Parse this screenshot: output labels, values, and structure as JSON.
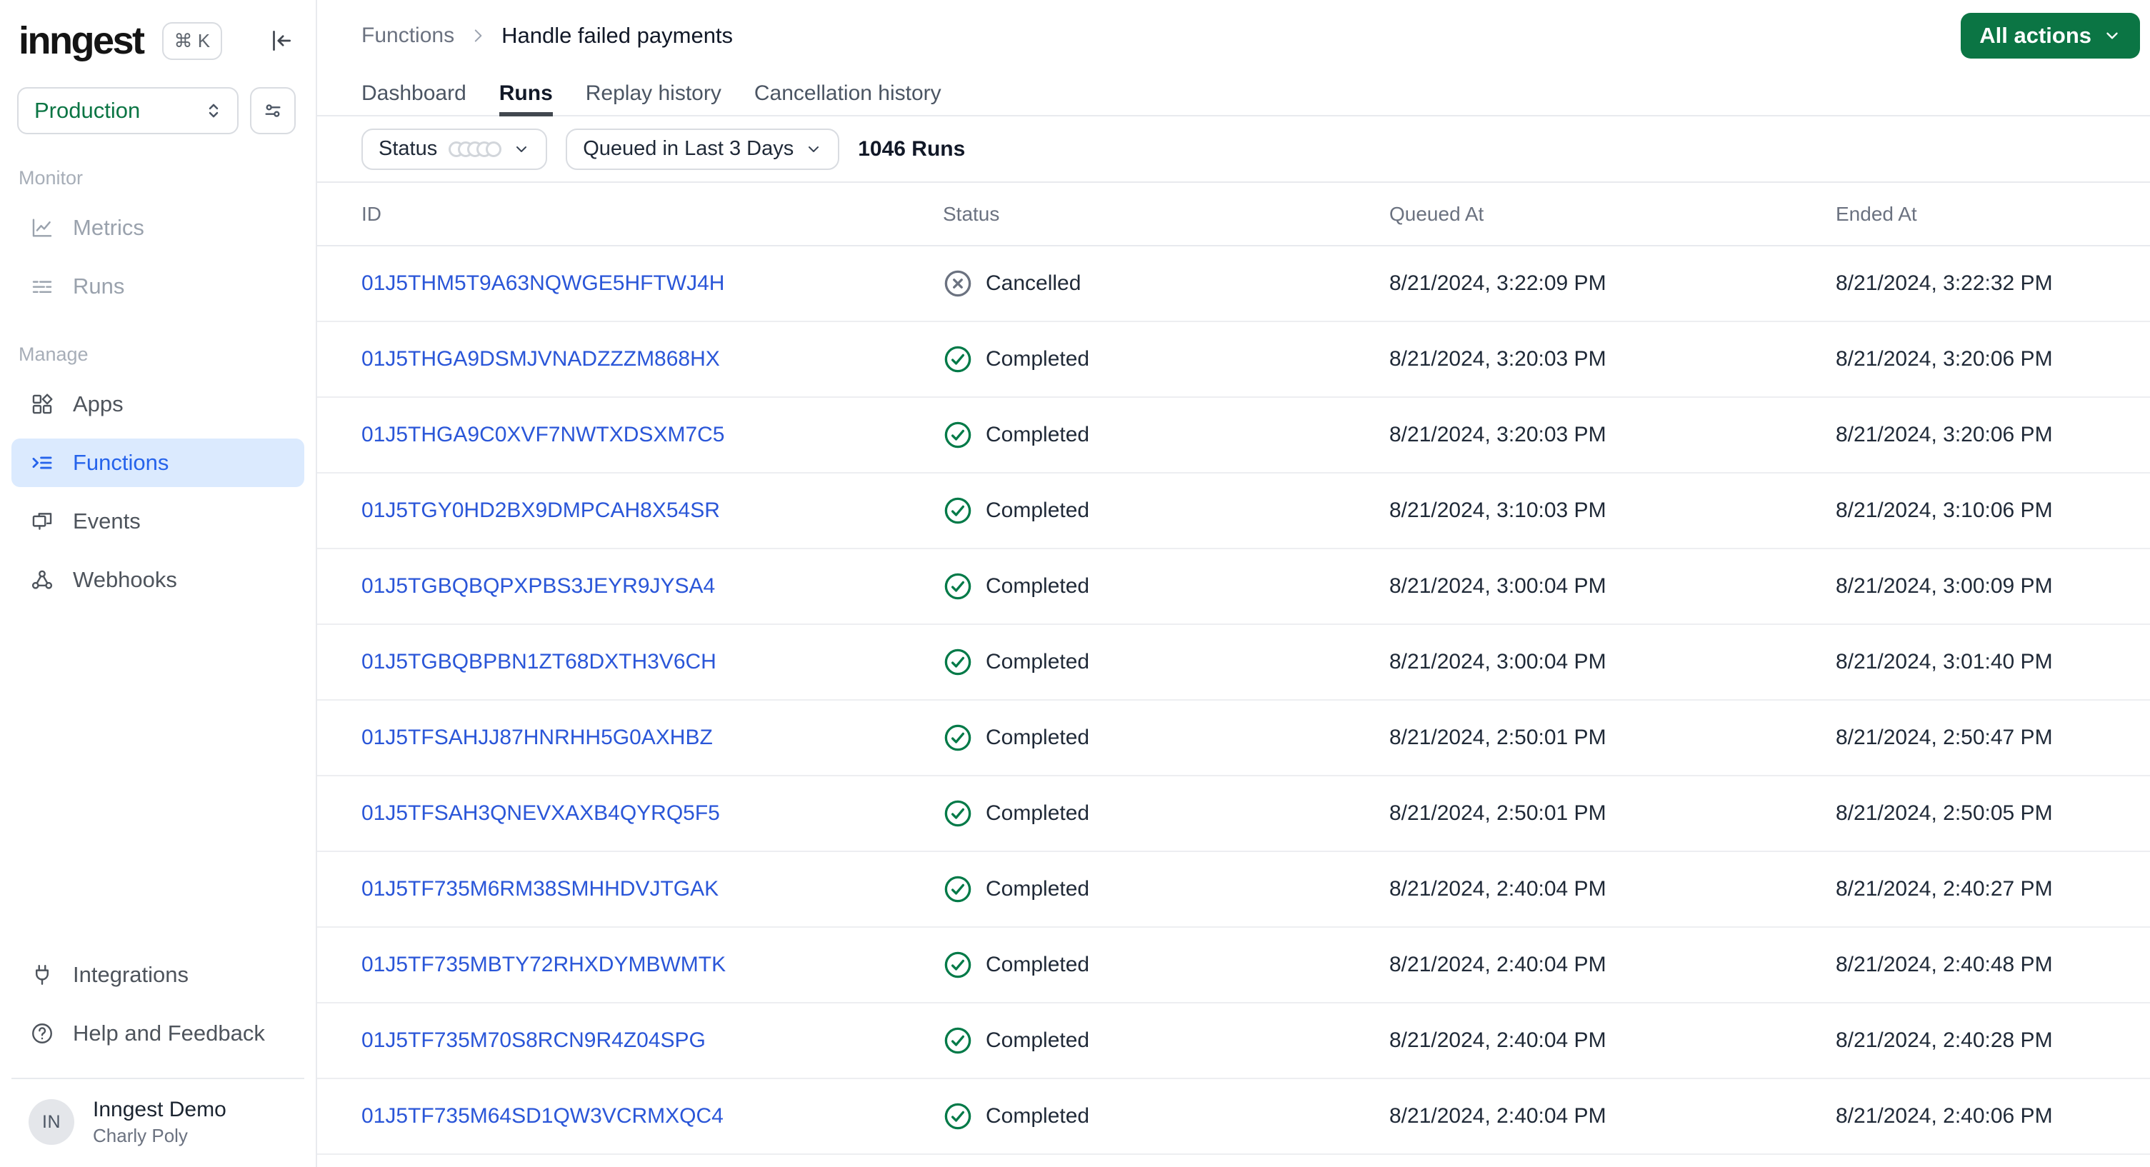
{
  "sidebar": {
    "logo": "inngest",
    "kbd_label": "⌘ K",
    "env_selector": {
      "value": "Production"
    },
    "sections": [
      {
        "label": "Monitor",
        "items": [
          {
            "label": "Metrics",
            "icon": "metrics-icon"
          },
          {
            "label": "Runs",
            "icon": "runs-icon"
          }
        ]
      },
      {
        "label": "Manage",
        "items": [
          {
            "label": "Apps",
            "icon": "apps-icon"
          },
          {
            "label": "Functions",
            "icon": "functions-icon",
            "active": true
          },
          {
            "label": "Events",
            "icon": "events-icon"
          },
          {
            "label": "Webhooks",
            "icon": "webhook-icon"
          }
        ]
      }
    ],
    "footer_items": [
      {
        "label": "Integrations",
        "icon": "plug-icon"
      },
      {
        "label": "Help and Feedback",
        "icon": "help-icon"
      }
    ],
    "user": {
      "initials": "IN",
      "org": "Inngest Demo",
      "name": "Charly Poly"
    }
  },
  "header": {
    "breadcrumb": {
      "parent": "Functions",
      "current": "Handle failed payments"
    },
    "actions_button": "All actions",
    "tabs": [
      {
        "label": "Dashboard"
      },
      {
        "label": "Runs",
        "active": true
      },
      {
        "label": "Replay history"
      },
      {
        "label": "Cancellation history"
      }
    ]
  },
  "filters": {
    "status_label": "Status",
    "time_range_label": "Queued in Last 3 Days",
    "runs_count": "1046 Runs"
  },
  "table": {
    "columns": [
      "ID",
      "Status",
      "Queued At",
      "Ended At"
    ],
    "rows": [
      {
        "id": "01J5THM5T9A63NQWGE5HFTWJ4H",
        "status": "Cancelled",
        "queued_at": "8/21/2024, 3:22:09 PM",
        "ended_at": "8/21/2024, 3:22:32 PM"
      },
      {
        "id": "01J5THGA9DSMJVNADZZZM868HX",
        "status": "Completed",
        "queued_at": "8/21/2024, 3:20:03 PM",
        "ended_at": "8/21/2024, 3:20:06 PM"
      },
      {
        "id": "01J5THGA9C0XVF7NWTXDSXM7C5",
        "status": "Completed",
        "queued_at": "8/21/2024, 3:20:03 PM",
        "ended_at": "8/21/2024, 3:20:06 PM"
      },
      {
        "id": "01J5TGY0HD2BX9DMPCAH8X54SR",
        "status": "Completed",
        "queued_at": "8/21/2024, 3:10:03 PM",
        "ended_at": "8/21/2024, 3:10:06 PM"
      },
      {
        "id": "01J5TGBQBQPXPBS3JEYR9JYSA4",
        "status": "Completed",
        "queued_at": "8/21/2024, 3:00:04 PM",
        "ended_at": "8/21/2024, 3:00:09 PM"
      },
      {
        "id": "01J5TGBQBPBN1ZT68DXTH3V6CH",
        "status": "Completed",
        "queued_at": "8/21/2024, 3:00:04 PM",
        "ended_at": "8/21/2024, 3:01:40 PM"
      },
      {
        "id": "01J5TFSAHJJ87HNRHH5G0AXHBZ",
        "status": "Completed",
        "queued_at": "8/21/2024, 2:50:01 PM",
        "ended_at": "8/21/2024, 2:50:47 PM"
      },
      {
        "id": "01J5TFSAH3QNEVXAXB4QYRQ5F5",
        "status": "Completed",
        "queued_at": "8/21/2024, 2:50:01 PM",
        "ended_at": "8/21/2024, 2:50:05 PM"
      },
      {
        "id": "01J5TF735M6RM38SMHHDVJTGAK",
        "status": "Completed",
        "queued_at": "8/21/2024, 2:40:04 PM",
        "ended_at": "8/21/2024, 2:40:27 PM"
      },
      {
        "id": "01J5TF735MBTY72RHXDYMBWMTK",
        "status": "Completed",
        "queued_at": "8/21/2024, 2:40:04 PM",
        "ended_at": "8/21/2024, 2:40:48 PM"
      },
      {
        "id": "01J5TF735M70S8RCN9R4Z04SPG",
        "status": "Completed",
        "queued_at": "8/21/2024, 2:40:04 PM",
        "ended_at": "8/21/2024, 2:40:28 PM"
      },
      {
        "id": "01J5TF735M64SD1QW3VCRMXQC4",
        "status": "Completed",
        "queued_at": "8/21/2024, 2:40:04 PM",
        "ended_at": "8/21/2024, 2:40:06 PM"
      }
    ]
  },
  "colors": {
    "brand_green": "#0b7544",
    "completed_green": "#027a48",
    "cancelled_gray": "#6b7280",
    "link_blue": "#2a56d8",
    "active_item_blue": "#2563eb",
    "active_item_bg": "#dbeafe"
  }
}
